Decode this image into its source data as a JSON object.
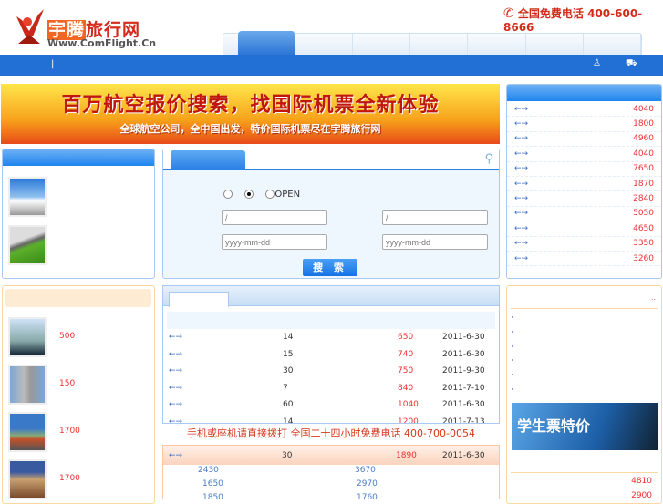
{
  "header": {
    "logo_cn": "宇腾旅行网",
    "logo_cn_highlight": "宇腾",
    "logo_cn_rest": "旅行网",
    "logo_en": "Www.ComFlight.Cn",
    "phone_label": "全国免费电话 400-600-8666"
  },
  "nav": {
    "separator": "|"
  },
  "banner": {
    "title": "百万航空报价搜索，找国际机票全新体验",
    "subtitle": "全球航空公司，全中国出发，特价国际机票尽在宇腾旅行网"
  },
  "right_list": {
    "arrow": "←→",
    "prices": [
      "4040",
      "1800",
      "4960",
      "4040",
      "7650",
      "1870",
      "2840",
      "5050",
      "4650",
      "3350",
      "3260"
    ]
  },
  "search": {
    "open_label": "OPEN",
    "from_placeholder": "/",
    "to_placeholder": "/",
    "date_placeholder": "yyyy-mm-dd",
    "button": "搜 索"
  },
  "left_deals": {
    "prices": [
      "500",
      "150",
      "1700",
      "1700"
    ]
  },
  "fares": {
    "arrow": "←→",
    "rows": [
      {
        "days": "14",
        "price": "650",
        "date": "2011-6-30"
      },
      {
        "days": "15",
        "price": "740",
        "date": "2011-6-30"
      },
      {
        "days": "30",
        "price": "750",
        "date": "2011-9-30"
      },
      {
        "days": "7",
        "price": "840",
        "date": "2011-7-10"
      },
      {
        "days": "60",
        "price": "1040",
        "date": "2011-6-30"
      },
      {
        "days": "14",
        "price": "1200",
        "date": "2011-7-13"
      }
    ]
  },
  "call_line": "手机或座机请直接拨打  全国二十四小时免费电话  400-700-0054",
  "orange_fares": {
    "row": {
      "days": "30",
      "price": "1890",
      "date": "2011-6-30"
    },
    "more": "..",
    "list": [
      "2430",
      "3670",
      "1650",
      "2970",
      "1850",
      "1760"
    ]
  },
  "right_col": {
    "more": "..",
    "student_banner": "学生票特价",
    "prices": [
      "4810",
      "2900"
    ]
  }
}
